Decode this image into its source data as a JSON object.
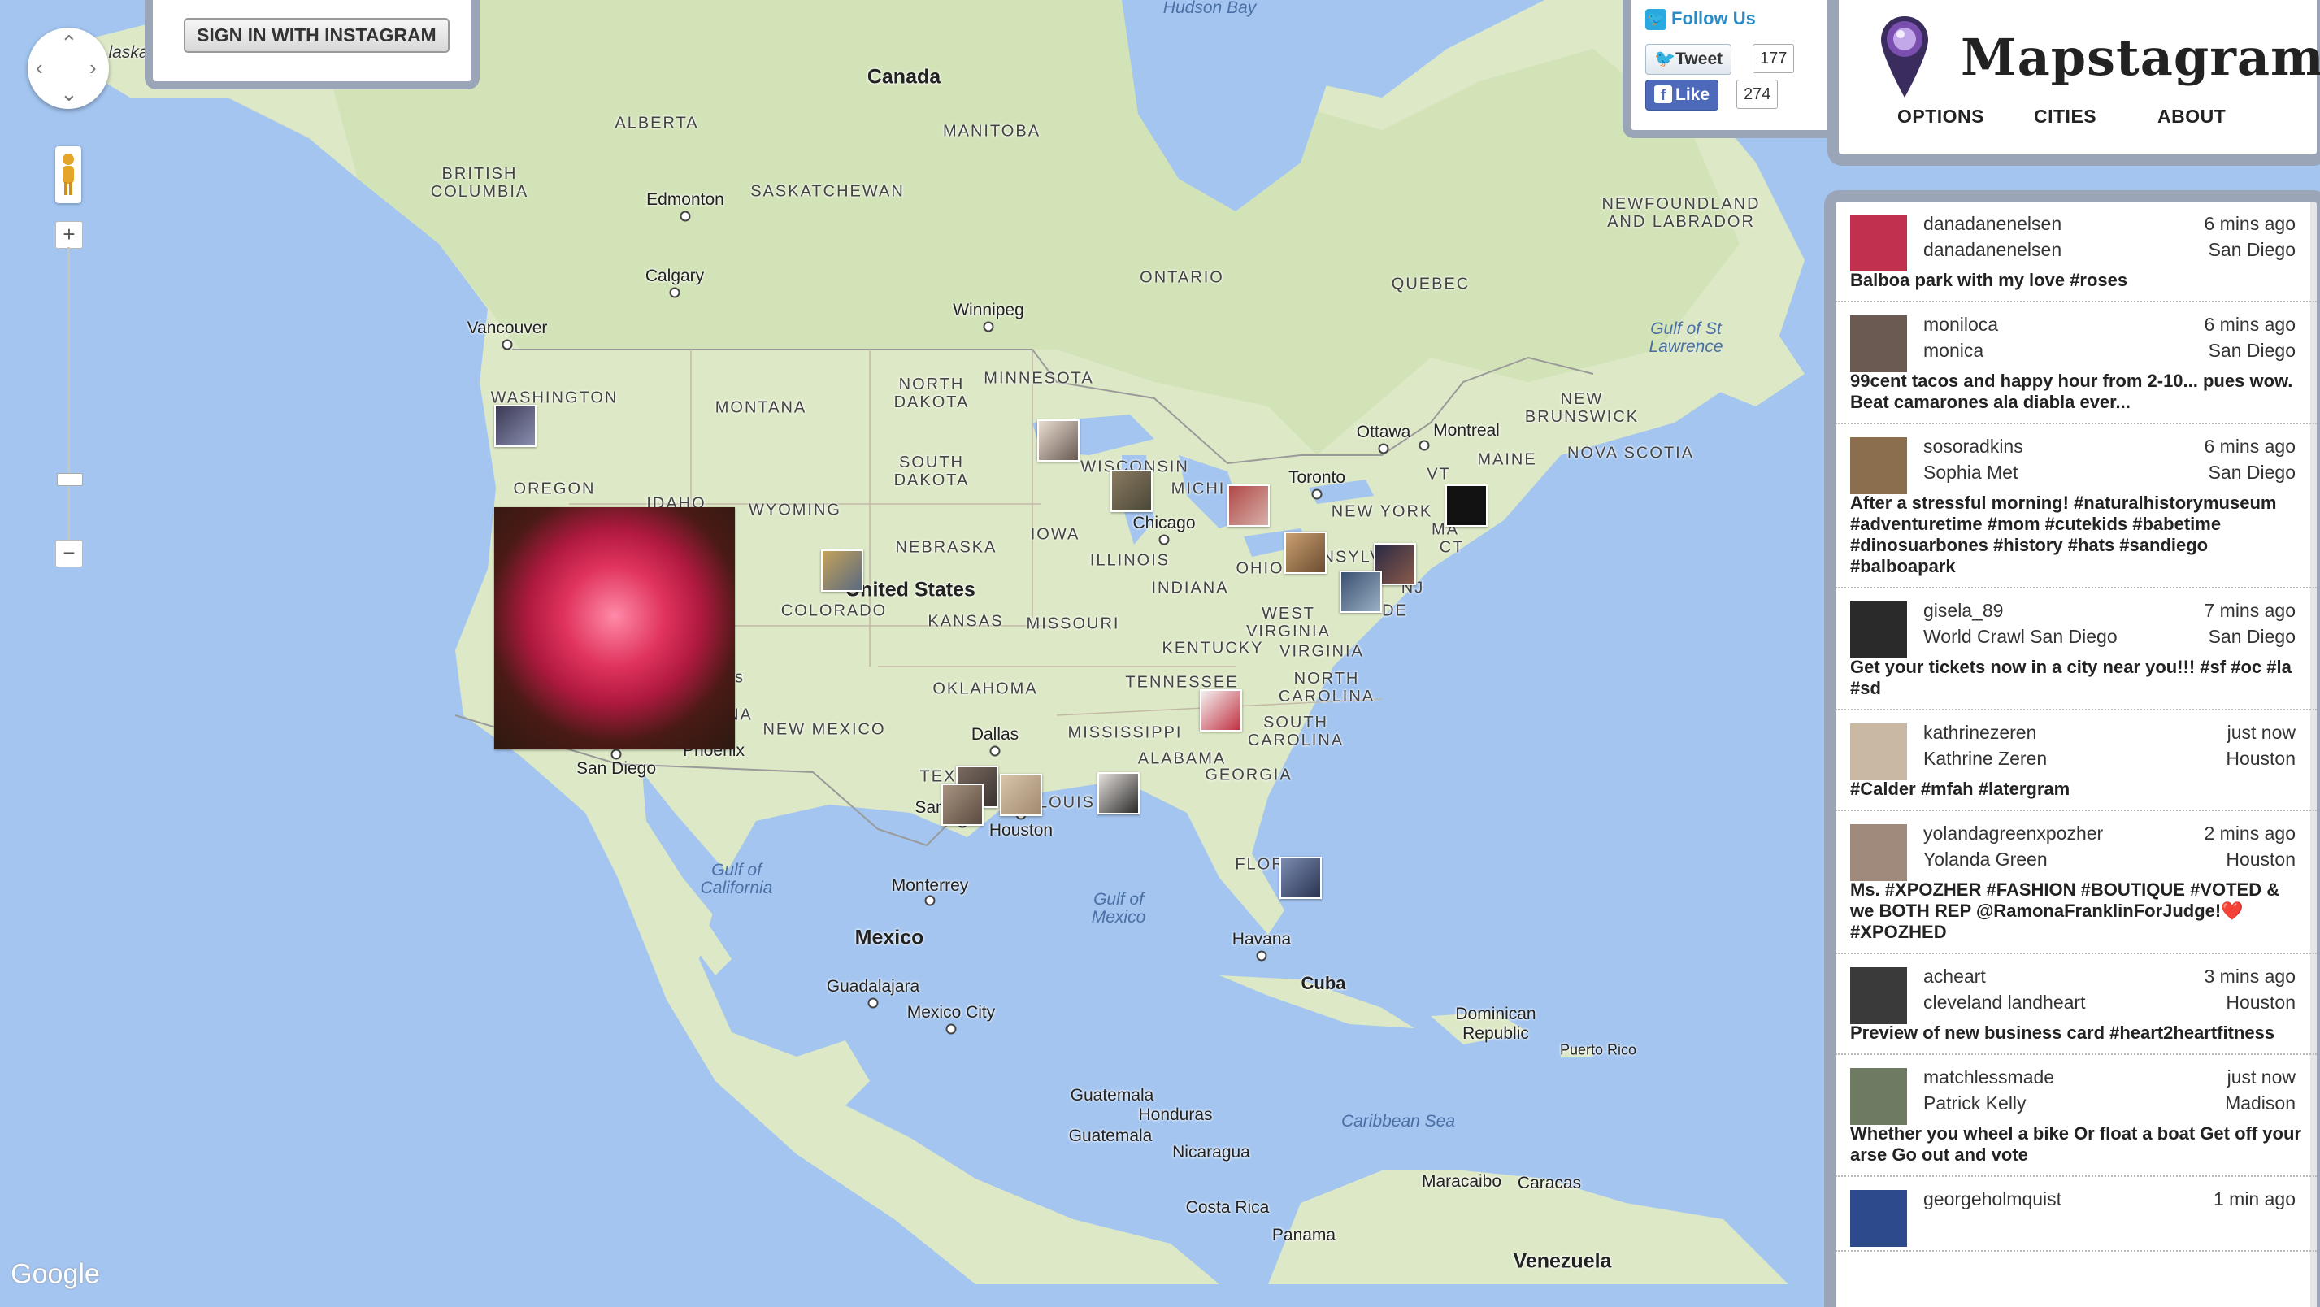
{
  "auth": {
    "signin_label": "SIGN IN WITH INSTAGRAM"
  },
  "social": {
    "follow_label": "Follow Us",
    "tweet_label": "Tweet",
    "tweet_count": "177",
    "like_label": "Like",
    "like_count": "274"
  },
  "brand": {
    "title": "Mapstagram",
    "nav": [
      "OPTIONS",
      "CITIES",
      "ABOUT"
    ]
  },
  "map": {
    "attribution": "Google",
    "labels": {
      "hudson_bay": "Hudson Bay",
      "canada": "Canada",
      "alaska": "laska",
      "alberta": "ALBERTA",
      "manitoba": "MANITOBA",
      "british_columbia": "BRITISH COLUMBIA",
      "saskatchewan": "SASKATCHEWAN",
      "ontario": "ONTARIO",
      "quebec": "QUEBEC",
      "newfoundland": "NEWFOUNDLAND AND LABRADOR",
      "gulf_st_lawrence": "Gulf of St Lawrence",
      "new_brunswick": "NEW BRUNSWICK",
      "nova_scotia": "NOVA SCOTIA",
      "washington": "WASHINGTON",
      "montana": "MONTANA",
      "north_dakota": "NORTH DAKOTA",
      "minnesota": "MINNESOTA",
      "south_dakota": "SOUTH DAKOTA",
      "wisconsin": "WISCONSIN",
      "michigan": "MICHI",
      "oregon": "OREGON",
      "idaho": "IDAHO",
      "wyoming": "WYOMING",
      "nebraska": "NEBRASKA",
      "iowa": "IOWA",
      "illinois": "ILLINOIS",
      "indiana": "INDIANA",
      "ohio": "OHIO",
      "new_york": "NEW YORK",
      "maine": "MAINE",
      "vt": "VT",
      "ma": "MA",
      "ct": "CT",
      "pennsylvania": "PENNSYLV",
      "nj": "NJ",
      "de": "DE",
      "colorado": "COLORADO",
      "united_states": "United States",
      "kansas": "KANSAS",
      "missouri": "MISSOURI",
      "west_virginia": "WEST VIRGINIA",
      "virginia": "VIRGINIA",
      "kentucky": "KENTUCKY",
      "tennessee": "TENNESSEE",
      "north_carolina": "NORTH CAROLINA",
      "south_carolina": "SOUTH CAROLINA",
      "oklahoma": "OKLAHOMA",
      "new_mexico": "NEW MEXICO",
      "mississippi": "MISSISSIPPI",
      "alabama": "ALABAMA",
      "georgia": "GEORGIA",
      "texas": "TEX",
      "louisiana": "LOUIS",
      "florida": "FLOR",
      "gulf_california": "Gulf of California",
      "gulf_mexico": "Gulf of Mexico",
      "mexico": "Mexico",
      "cuba": "Cuba",
      "dominican": "Dominican Republic",
      "caribbean": "Caribbean Sea",
      "venezuela": "Venezuela",
      "honduras": "Honduras",
      "nicaragua": "Nicaragua",
      "guatemala_country": "Guatemala",
      "costa_rica": "Costa Rica",
      "s_label": "s",
      "na_label": "NA"
    },
    "cities": {
      "vancouver": "Vancouver",
      "edmonton": "Edmonton",
      "calgary": "Calgary",
      "winnipeg": "Winnipeg",
      "ottawa": "Ottawa",
      "montreal": "Montreal",
      "toronto": "Toronto",
      "chicago": "Chicago",
      "dallas": "Dallas",
      "houston": "Houston",
      "san_antonio": "San",
      "phoenix": "Phoenix",
      "san_diego": "San Diego",
      "monterrey": "Monterrey",
      "guadalajara": "Guadalajara",
      "mexico_city": "Mexico City",
      "havana": "Havana",
      "puerto_rico": "Puerto Rico",
      "maracaibo": "Maracaibo",
      "caracas": "Caracas",
      "panama": "Panama",
      "guatemala_city": "Guatemala"
    }
  },
  "feed": [
    {
      "username": "danadanenelsen",
      "fullname": "danadanenelsen",
      "time": "6 mins ago",
      "city": "San Diego",
      "caption": "Balboa park with my love #roses",
      "avatar_color": "#c2304f"
    },
    {
      "username": "moniloca",
      "fullname": "monica",
      "time": "6 mins ago",
      "city": "San Diego",
      "caption": "99cent tacos and happy hour from 2-10... pues wow. Beat camarones ala diabla ever...",
      "avatar_color": "#6b5a52"
    },
    {
      "username": "sosoradkins",
      "fullname": "Sophia Met",
      "time": "6 mins ago",
      "city": "San Diego",
      "caption": "After a stressful morning! #naturalhistorymuseum #adventuretime #mom #cutekids #babetime #dinosuarbones #history #hats #sandiego #balboapark",
      "avatar_color": "#8a6e4e"
    },
    {
      "username": "gisela_89",
      "fullname": "World Crawl San Diego",
      "time": "7 mins ago",
      "city": "San Diego",
      "caption": "Get your tickets now in a city near you!!! #sf #oc #la #sd",
      "avatar_color": "#2a2a2a"
    },
    {
      "username": "kathrinezeren",
      "fullname": "Kathrine Zeren",
      "time": "just now",
      "city": "Houston",
      "caption": "#Calder #mfah #latergram",
      "avatar_color": "#c9b9a4"
    },
    {
      "username": "yolandagreenxpozher",
      "fullname": "Yolanda Green",
      "time": "2 mins ago",
      "city": "Houston",
      "caption": "Ms. #XPOZHER #FASHION #BOUTIQUE #VOTED & we BOTH REP @RamonaFranklinForJudge!❤️#XPOZHED",
      "avatar_color": "#a08a7c"
    },
    {
      "username": "acheart",
      "fullname": "cleveland landheart",
      "time": "3 mins ago",
      "city": "Houston",
      "caption": "Preview of new business card #heart2heartfitness",
      "avatar_color": "#3a3a3a"
    },
    {
      "username": "matchlessmade",
      "fullname": "Patrick Kelly",
      "time": "just now",
      "city": "Madison",
      "caption": "Whether you wheel a bike Or float a boat Get off your arse Go out and vote",
      "avatar_color": "#6f7a62"
    },
    {
      "username": "georgeholmquist",
      "fullname": "",
      "time": "1 min ago",
      "city": "",
      "caption": "",
      "avatar_color": "#2c4a8c"
    }
  ]
}
